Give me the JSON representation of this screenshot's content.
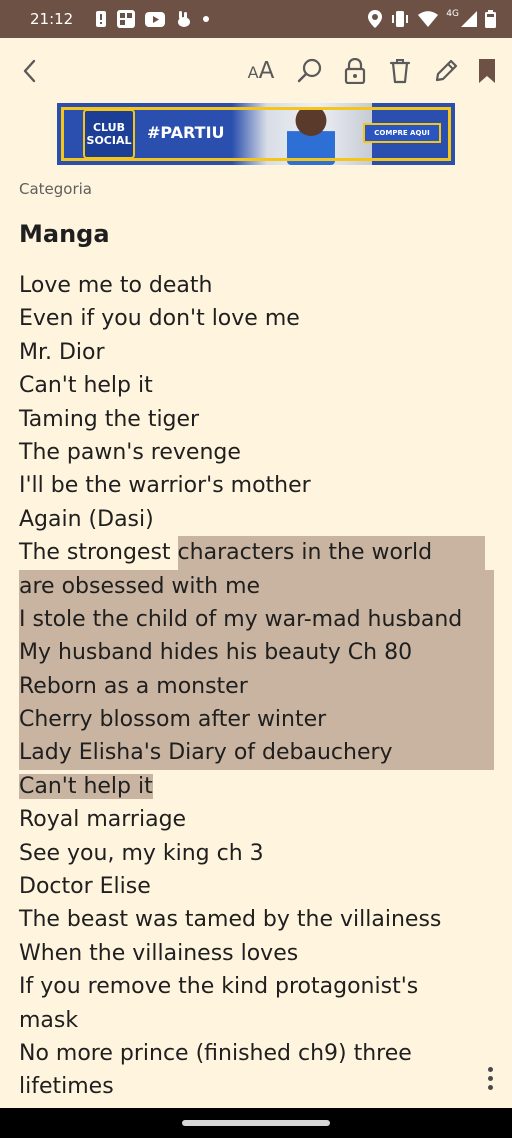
{
  "status_bar": {
    "time": "21:12",
    "network_label": "4G",
    "left_icons": [
      "alert-icon",
      "app-grid-icon",
      "youtube-icon",
      "rabbit-icon",
      "dot-icon"
    ],
    "right_icons": [
      "location-icon",
      "vibrate-icon",
      "wifi-icon",
      "signal-icon",
      "battery-icon"
    ]
  },
  "toolbar": {
    "icons": [
      "back-arrow-icon",
      "font-size-icon",
      "search-icon",
      "lock-icon",
      "trash-icon",
      "edit-pencil-icon",
      "bookmark-icon"
    ],
    "font_size_small": "A",
    "font_size_big": "A"
  },
  "ad": {
    "brand": "CLUB SOCIAL",
    "brand_line1": "CLUB",
    "brand_line2": "SOCIAL",
    "tagline": "#PARTIU",
    "cta": "COMPRE AQUI"
  },
  "note": {
    "category_label": "Categoria",
    "title": "Manga",
    "lines": [
      "Love me to death",
      "Even if you don't love me",
      "Mr. Dior",
      "Can't help it",
      "Taming the tiger",
      "The pawn's revenge",
      "I'll be the warrior's mother",
      "Again (Dasi)",
      "The strongest characters in the world",
      "are obsessed with me",
      "I stole the child of my war-mad husband",
      "My husband hides his beauty Ch 80",
      "Reborn as a monster",
      "Cherry blossom after winter",
      "Lady Elisha's Diary of debauchery",
      "Can't help it",
      "Royal marriage",
      "See you, my king ch 3",
      "Doctor Elise",
      "The beast was tamed by the villainess",
      "When the villainess loves",
      "If you remove the kind protagonist's",
      "mask",
      "No more prince (finished ch9) three",
      "lifetimes"
    ],
    "selection": {
      "start_line_prefix": "The strongest ",
      "start_line_selected": "characters in the world",
      "highlight_color": "#c8b4a0"
    }
  },
  "colors": {
    "background": "#fff4de",
    "status_bar": "#6e5145",
    "text": "#1f1f1f",
    "secondary_text": "#5f5f5f",
    "bookmark": "#6e5145"
  }
}
